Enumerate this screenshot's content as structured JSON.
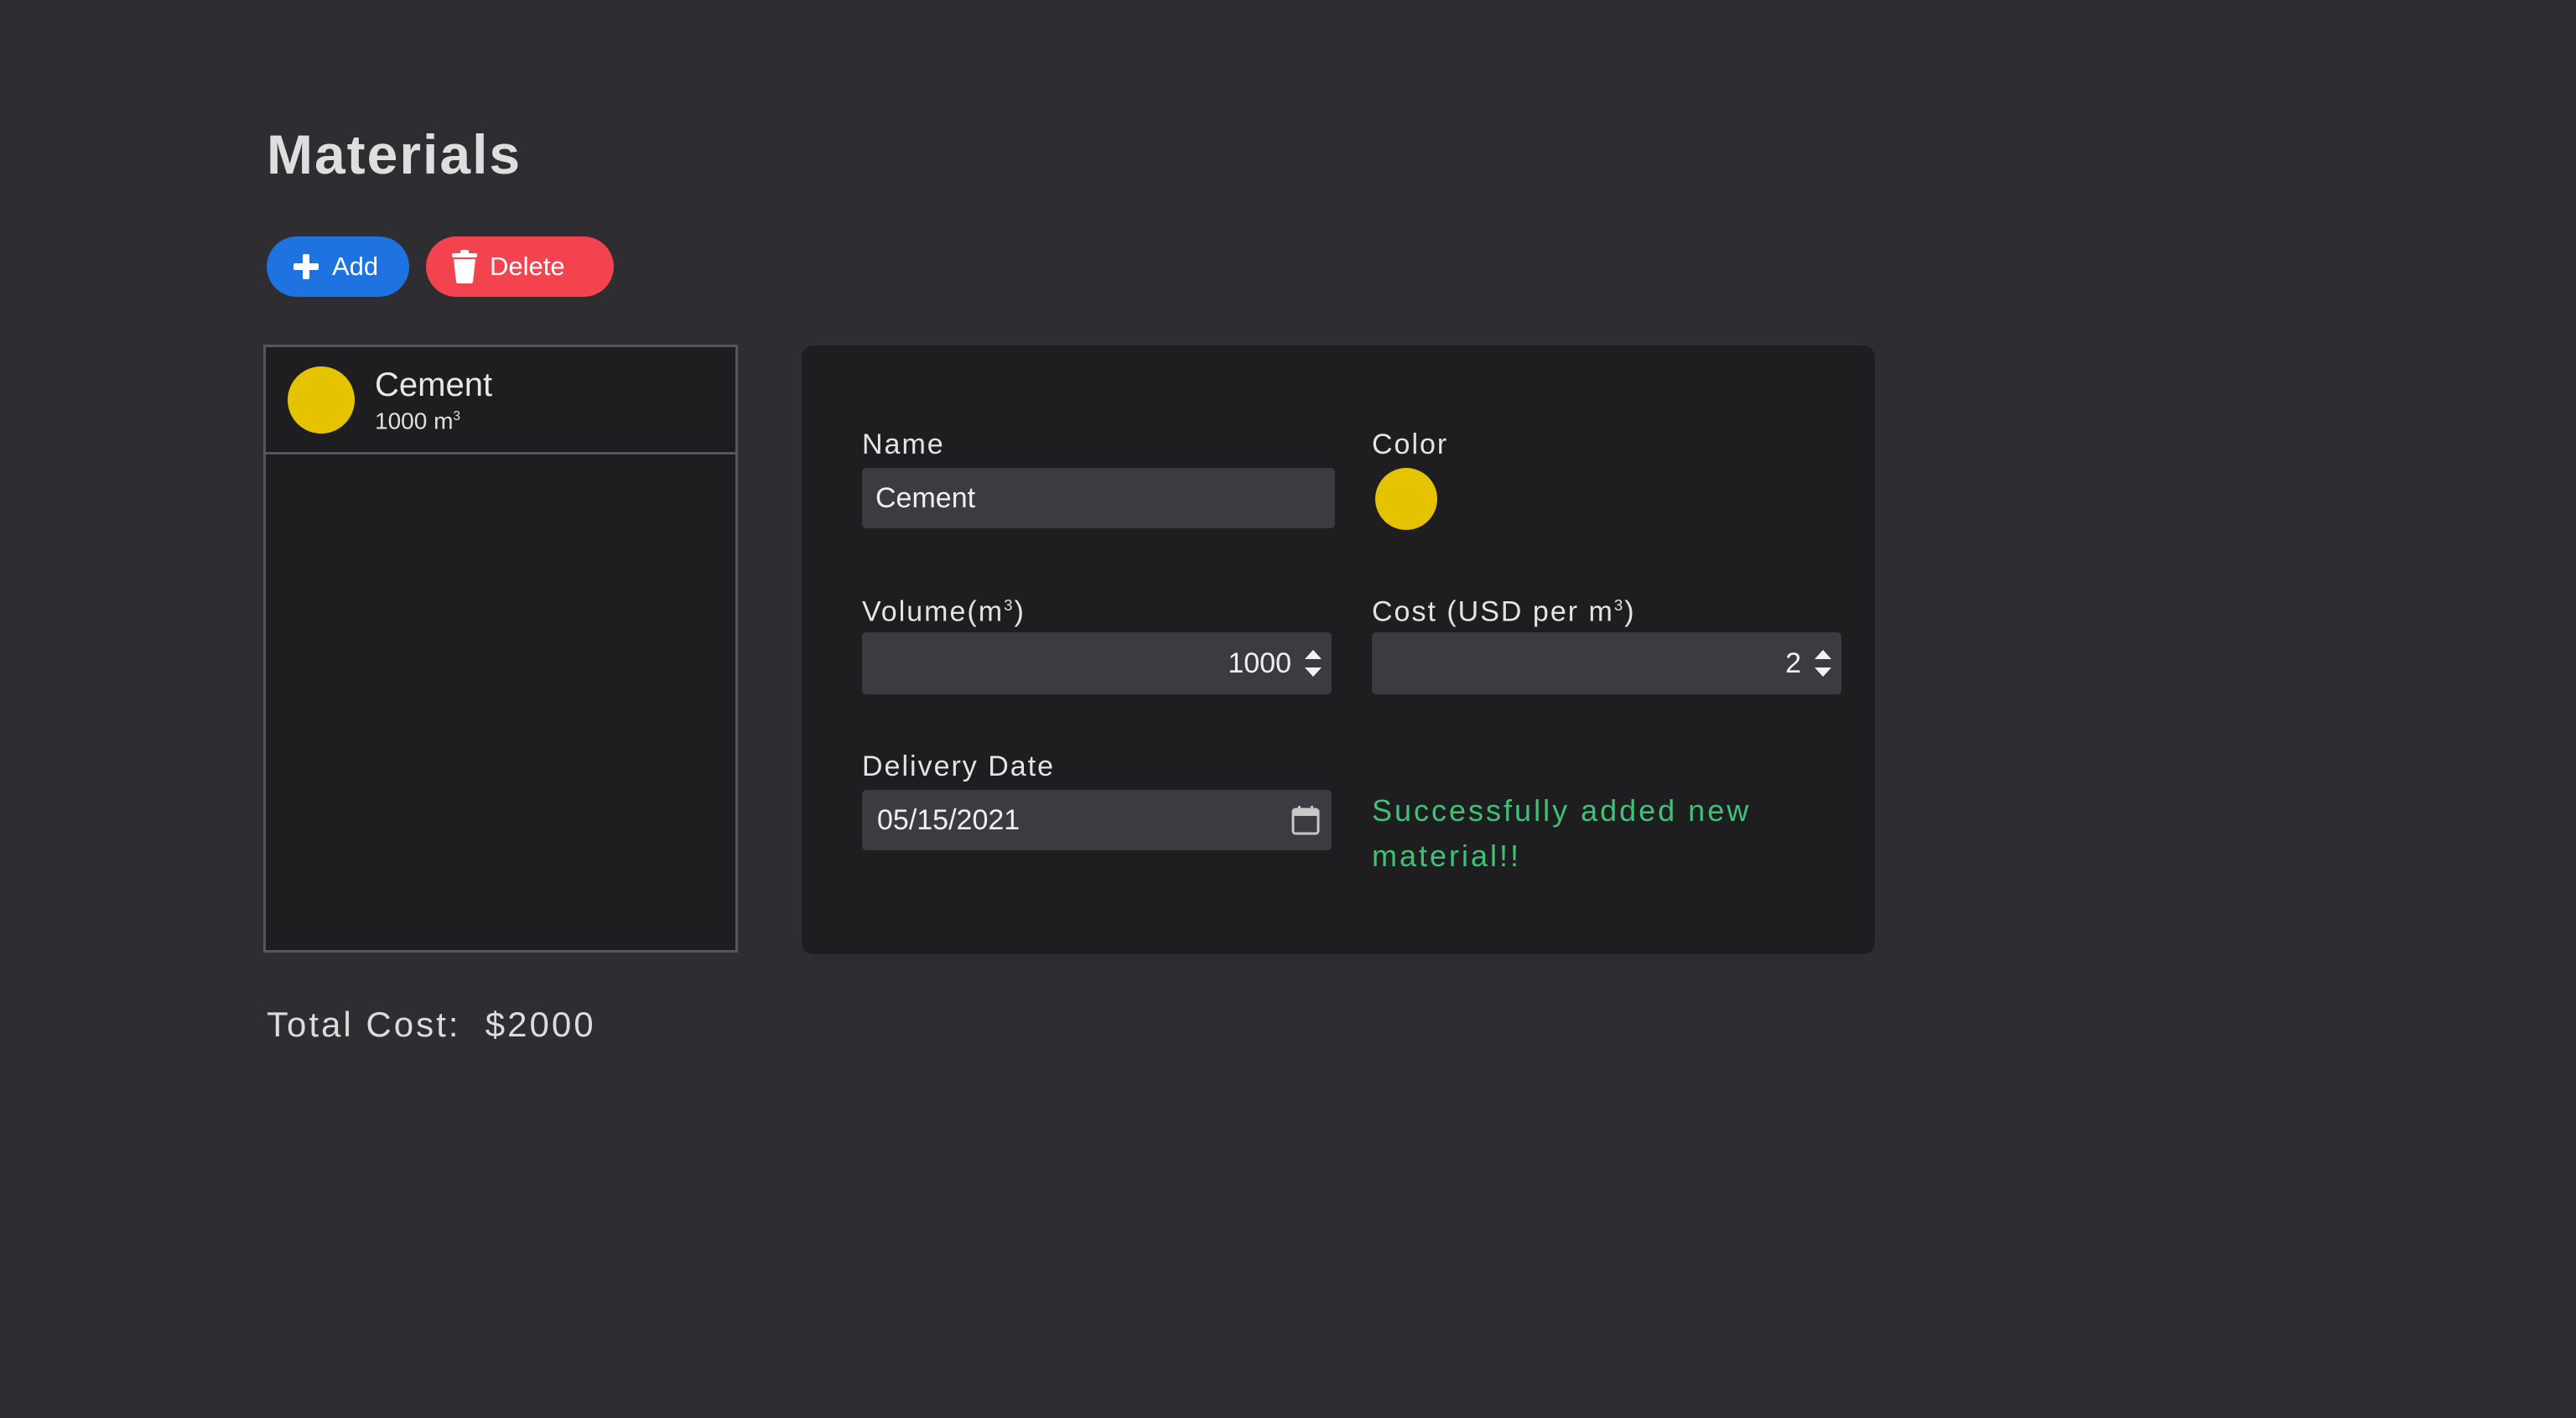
{
  "page": {
    "title": "Materials"
  },
  "toolbar": {
    "add_label": "Add",
    "add_icon": "plus-icon",
    "delete_label": "Delete",
    "delete_icon": "trash-icon",
    "add_color": "#1e73e0",
    "delete_color": "#f2434f"
  },
  "materials_list": {
    "items": [
      {
        "name": "Cement",
        "volume_text": "1000 m",
        "unit_sup": "3",
        "color": "#e6c300"
      }
    ]
  },
  "form": {
    "name_label": "Name",
    "name_value": "Cement",
    "color_label": "Color",
    "color_value": "#e6c300",
    "volume_label": "Volume(m",
    "volume_label_sup": "3",
    "volume_label_end": ")",
    "volume_value": "1000",
    "cost_label": "Cost (USD per m",
    "cost_label_sup": "3",
    "cost_label_end": ")",
    "cost_value": "2",
    "date_label": "Delivery Date",
    "date_value": "05/15/2021",
    "date_icon": "calendar-icon",
    "success_message": "Successfully added new material!!",
    "success_color": "#3fc276"
  },
  "footer": {
    "total_label": "Total Cost:",
    "total_value": "$2000"
  }
}
